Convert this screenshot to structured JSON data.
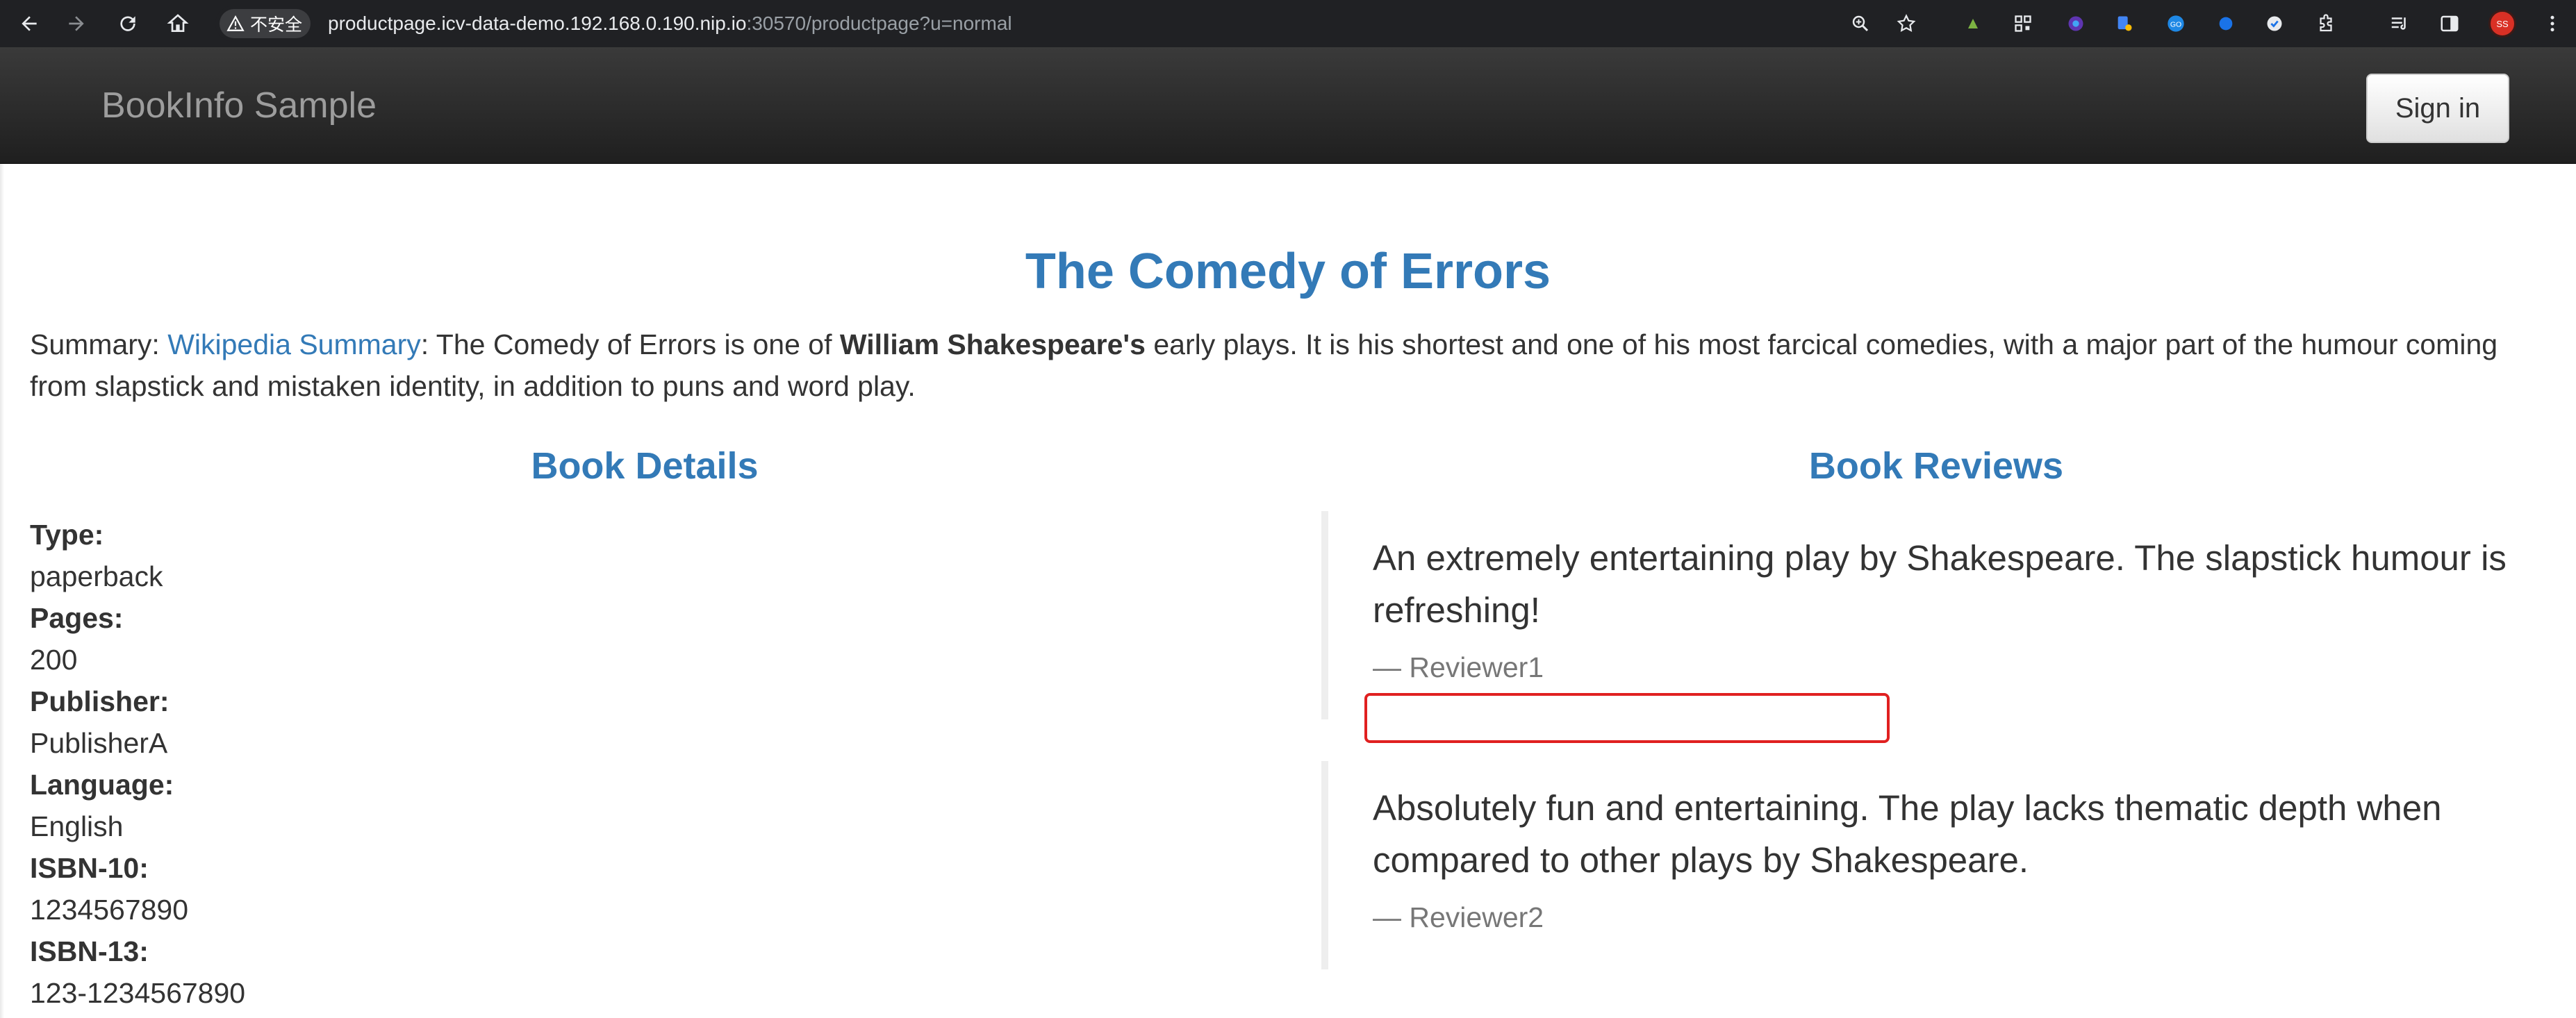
{
  "browser": {
    "security_label": "不安全",
    "url_host": "productpage.icv-data-demo.192.168.0.190.nip.io",
    "url_rest": ":30570/productpage?u=normal",
    "avatar_initials": "SS",
    "icons": [
      "back-icon",
      "forward-icon",
      "reload-icon",
      "home-icon",
      "warning-icon",
      "zoom-icon",
      "star-icon",
      "extensions-icon",
      "reading-list-icon",
      "sidepanel-icon",
      "menu-icon"
    ]
  },
  "navbar": {
    "brand": "BookInfo Sample",
    "signin_label": "Sign in"
  },
  "book": {
    "title": "The Comedy of Errors",
    "summary_prefix": "Summary: ",
    "summary_link": "Wikipedia Summary",
    "summary_text_1": ": The Comedy of Errors is one of ",
    "summary_bold": "William Shakespeare's",
    "summary_text_2": " early plays. It is his shortest and one of his most farcical comedies, with a major part of the humour coming from slapstick and mistaken identity, in addition to puns and word play."
  },
  "details": {
    "heading": "Book Details",
    "fields": [
      {
        "label": "Type:",
        "value": "paperback"
      },
      {
        "label": "Pages:",
        "value": "200"
      },
      {
        "label": "Publisher:",
        "value": "PublisherA"
      },
      {
        "label": "Language:",
        "value": "English"
      },
      {
        "label": "ISBN-10:",
        "value": "1234567890"
      },
      {
        "label": "ISBN-13:",
        "value": "123-1234567890"
      }
    ]
  },
  "reviews": {
    "heading": "Book Reviews",
    "items": [
      {
        "text": "An extremely entertaining play by Shakespeare. The slapstick humour is refreshing!",
        "author": "— Reviewer1"
      },
      {
        "text": "Absolutely fun and entertaining. The play lacks thematic depth when compared to other plays by Shakespeare.",
        "author": "— Reviewer2"
      }
    ]
  },
  "colors": {
    "accent": "#337ab7",
    "navbar": "#222222",
    "highlight": "#e02020"
  }
}
